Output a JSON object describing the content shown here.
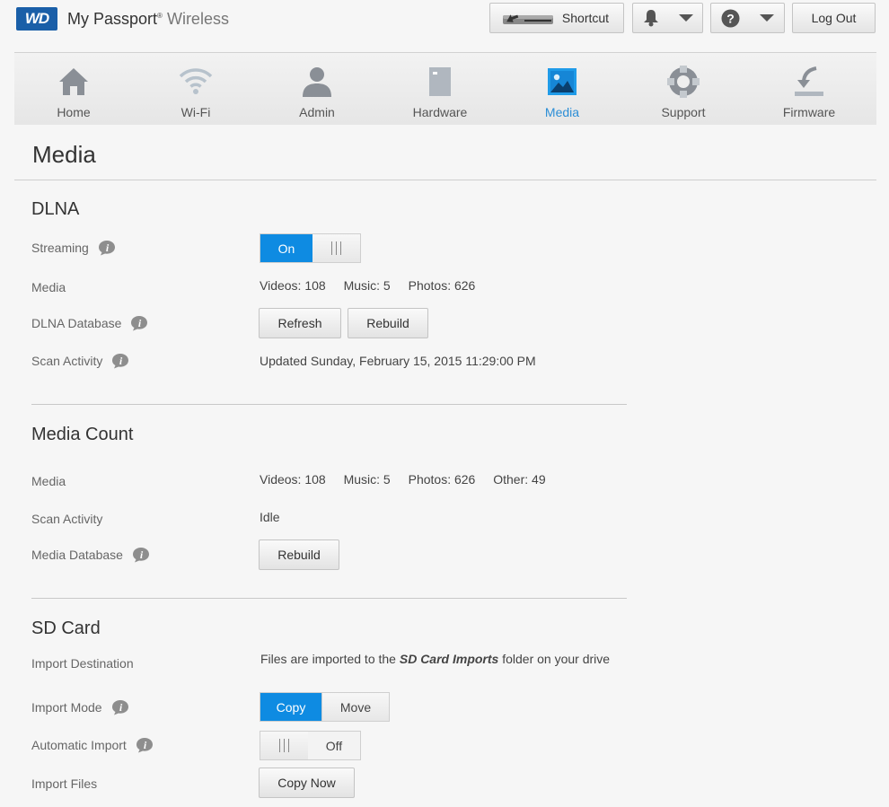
{
  "header": {
    "logo_text": "WD",
    "product_name": "My Passport",
    "product_reg": "®",
    "product_suffix": "Wireless",
    "shortcut_label": "Shortcut",
    "logout_label": "Log Out"
  },
  "nav": {
    "items": [
      {
        "label": "Home",
        "icon": "home-icon"
      },
      {
        "label": "Wi-Fi",
        "icon": "wifi-icon"
      },
      {
        "label": "Admin",
        "icon": "user-icon"
      },
      {
        "label": "Hardware",
        "icon": "drive-icon"
      },
      {
        "label": "Media",
        "icon": "image-icon",
        "active": true
      },
      {
        "label": "Support",
        "icon": "lifebuoy-icon"
      },
      {
        "label": "Firmware",
        "icon": "download-icon"
      }
    ],
    "active_color": "#2c8ed6"
  },
  "page": {
    "title": "Media"
  },
  "dlna": {
    "title": "DLNA",
    "streaming_label": "Streaming",
    "streaming_state": "On",
    "media_label": "Media",
    "videos": "Videos: 108",
    "music": "Music: 5",
    "photos": "Photos: 626",
    "database_label": "DLNA Database",
    "refresh_label": "Refresh",
    "rebuild_label": "Rebuild",
    "scan_label": "Scan Activity",
    "scan_value": "Updated Sunday, February 15, 2015 11:29:00 PM"
  },
  "media_count": {
    "title": "Media Count",
    "media_label": "Media",
    "videos": "Videos: 108",
    "music": "Music: 5",
    "photos": "Photos: 626",
    "other": "Other: 49",
    "scan_label": "Scan Activity",
    "scan_value": "Idle",
    "database_label": "Media Database",
    "rebuild_label": "Rebuild"
  },
  "sd_card": {
    "title": "SD Card",
    "destination_label": "Import Destination",
    "destination_prefix": "Files are imported to the",
    "destination_folder": "SD Card Imports",
    "destination_suffix": "folder on your drive",
    "mode_label": "Import Mode",
    "mode_copy": "Copy",
    "mode_move": "Move",
    "auto_label": "Automatic Import",
    "auto_state": "Off",
    "files_label": "Import Files",
    "copy_now_label": "Copy Now"
  },
  "colors": {
    "accent": "#0e8be2",
    "brand": "#1a5fa8"
  }
}
